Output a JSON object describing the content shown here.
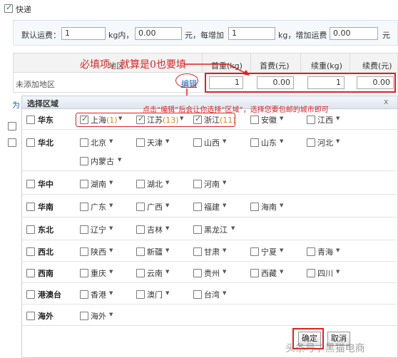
{
  "shipping": {
    "method_label": "快递",
    "default_fee_label": "默认运费：",
    "default_fee_value": "1",
    "kg_within": "kg内，",
    "default_price": "0.00",
    "yuan_each_add": "元，每增加",
    "add_weight": "1",
    "kg_add_fee": "kg，增加运费",
    "add_fee": "0.00",
    "yuan": "元"
  },
  "table": {
    "headers": [
      "首重(kg)",
      "首费(元)",
      "续重(kg)",
      "续费(元)"
    ],
    "row_label": "未添加地区",
    "edit_link": "编辑",
    "values": [
      "1",
      "0.00",
      "1",
      "0.00"
    ],
    "partial_header": "地区",
    "side_char": "为"
  },
  "annotations": {
    "required_note": "必填项，就算是0也要填",
    "edit_hint": "点击“编辑”后会让你选择“区域”，选择您要包邮的城市即可"
  },
  "dialog": {
    "title": "选择区域",
    "close": "x",
    "ok": "确定",
    "cancel": "取消",
    "regions": [
      {
        "name": "华东",
        "checked": false,
        "provinces": [
          {
            "name": "上海",
            "count": "(1)",
            "checked": true
          },
          {
            "name": "江苏",
            "count": "(13)",
            "checked": true
          },
          {
            "name": "浙江",
            "count": "(11)",
            "checked": true
          },
          {
            "name": "安徽",
            "count": "",
            "checked": false
          },
          {
            "name": "江西",
            "count": "",
            "checked": false
          }
        ]
      },
      {
        "name": "华北",
        "checked": false,
        "provinces": [
          {
            "name": "北京",
            "checked": false
          },
          {
            "name": "天津",
            "checked": false
          },
          {
            "name": "山西",
            "checked": false
          },
          {
            "name": "山东",
            "checked": false
          },
          {
            "name": "河北",
            "checked": false
          },
          {
            "name": "内蒙古",
            "checked": false
          }
        ]
      },
      {
        "name": "华中",
        "checked": false,
        "provinces": [
          {
            "name": "湖南",
            "checked": false
          },
          {
            "name": "湖北",
            "checked": false
          },
          {
            "name": "河南",
            "checked": false
          }
        ]
      },
      {
        "name": "华南",
        "checked": false,
        "provinces": [
          {
            "name": "广东",
            "checked": false
          },
          {
            "name": "广西",
            "checked": false
          },
          {
            "name": "福建",
            "checked": false
          },
          {
            "name": "海南",
            "checked": false
          }
        ]
      },
      {
        "name": "东北",
        "checked": false,
        "provinces": [
          {
            "name": "辽宁",
            "checked": false
          },
          {
            "name": "吉林",
            "checked": false
          },
          {
            "name": "黑龙江",
            "checked": false
          }
        ]
      },
      {
        "name": "西北",
        "checked": false,
        "provinces": [
          {
            "name": "陕西",
            "checked": false
          },
          {
            "name": "新疆",
            "checked": false
          },
          {
            "name": "甘肃",
            "checked": false
          },
          {
            "name": "宁夏",
            "checked": false
          },
          {
            "name": "青海",
            "checked": false
          }
        ]
      },
      {
        "name": "西南",
        "checked": false,
        "provinces": [
          {
            "name": "重庆",
            "checked": false
          },
          {
            "name": "云南",
            "checked": false
          },
          {
            "name": "贵州",
            "checked": false
          },
          {
            "name": "西藏",
            "checked": false
          },
          {
            "name": "四川",
            "checked": false
          }
        ]
      },
      {
        "name": "港澳台",
        "checked": false,
        "provinces": [
          {
            "name": "香港",
            "checked": false
          },
          {
            "name": "澳门",
            "checked": false
          },
          {
            "name": "台湾",
            "checked": false
          }
        ]
      },
      {
        "name": "海外",
        "checked": false,
        "provinces": [
          {
            "name": "海外",
            "checked": false
          }
        ]
      }
    ]
  },
  "watermark": "头条号 / 黑猫电商"
}
